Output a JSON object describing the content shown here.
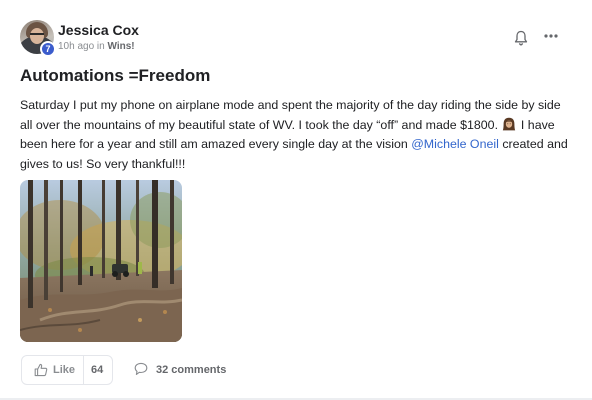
{
  "post": {
    "author": "Jessica Cox",
    "level": "7",
    "time": "10h ago in",
    "category": "Wins!",
    "title": "Automations =Freedom",
    "body_part1": "Saturday I put my phone on airplane mode and spent the majority of the day riding the side by side all over the mountains of my beautiful state of WV. I took the day “off” and made $1800.",
    "body_part2": "I have been here for a year and still am amazed every single day at the vision",
    "mention": "@Michele Oneil",
    "body_part3": "created and gives to us! So very thankful!!!",
    "emoji": "woman-with-long-hair-emoji"
  },
  "actions": {
    "like_label": "Like",
    "like_count": "64",
    "comments_label": "32 comments"
  },
  "header_icons": {
    "bell": "bell-icon",
    "more": "more-dots-icon"
  },
  "colors": {
    "mention": "#3366cc",
    "badge": "#3b5ccc",
    "muted": "#8a8d91"
  }
}
